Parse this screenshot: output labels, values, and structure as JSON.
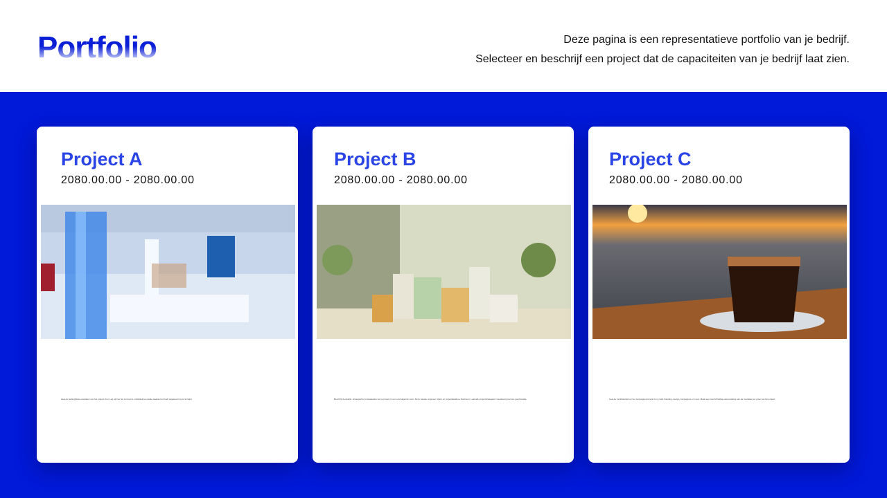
{
  "header": {
    "title": "Portfolio",
    "intro_line1": "Deze pagina is een representatieve portfolio van je bedrijf.",
    "intro_line2": "Selecteer en beschrijf een project dat de capaciteiten van je bedrijf laat zien."
  },
  "colors": {
    "brand": "#0119d9",
    "card_title": "#2a44e6"
  },
  "projects": [
    {
      "title": "Project A",
      "date": "2080.00.00 - 2080.00.00",
      "image": "futuristic-retail-store",
      "description": "Laat de belangrijkste resultaten van het project zien. Leg uit hoe het concept is ontwikkeld en welke waarde het heeft opgeleverd voor de klant."
    },
    {
      "title": "Project B",
      "date": "2080.00.00 - 2080.00.00",
      "image": "cosmetic-bottles-with-plants",
      "description": "Beschrijf de details, strategische inzetwaarden van je project in een overtuigende vorm. Deze visuele ongeveer cijfers en projectdetails te illustreren. Laat alle projectstrategieën nauwkeurig kennen goed details."
    },
    {
      "title": "Project C",
      "date": "2080.00.00 - 2080.00.00",
      "image": "coffee-cup-at-sunset",
      "description": "Laat de merkidentiteit en het campagneconcept zien, zoals branding, design, campagnes en meer. Maak een overzichtelijke samenvatting van de resultaten en groei van het project."
    }
  ]
}
